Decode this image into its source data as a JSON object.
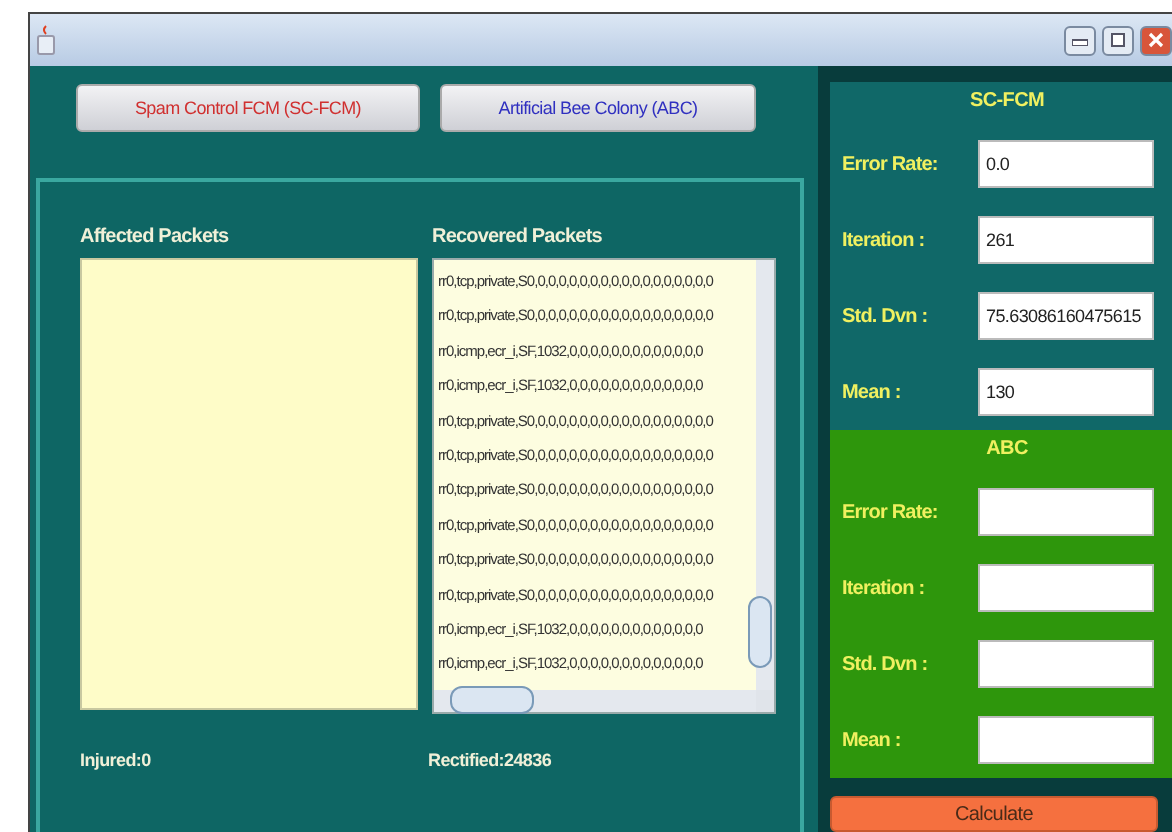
{
  "buttons": [
    {
      "label": "Spam Control FCM (SC-FCM)",
      "color": "#d03030"
    },
    {
      "label": "Artificial Bee Colony (ABC)",
      "color": "#3030c0"
    }
  ],
  "affected": {
    "label": "Affected Packets"
  },
  "recovered": {
    "label": "Recovered Packets",
    "rows": [
      "rr0,tcp,private,S0,0,0,0,0,0,0,0,0,0,0,0,0,0,0,0,0,0",
      "rr0,tcp,private,S0,0,0,0,0,0,0,0,0,0,0,0,0,0,0,0,0,0",
      "rr0,icmp,ecr_i,SF,1032,0,0,0,0,0,0,0,0,0,0,0,0,0",
      "rr0,icmp,ecr_i,SF,1032,0,0,0,0,0,0,0,0,0,0,0,0,0",
      "rr0,tcp,private,S0,0,0,0,0,0,0,0,0,0,0,0,0,0,0,0,0,0",
      "rr0,tcp,private,S0,0,0,0,0,0,0,0,0,0,0,0,0,0,0,0,0,0",
      "rr0,tcp,private,S0,0,0,0,0,0,0,0,0,0,0,0,0,0,0,0,0,0",
      "rr0,tcp,private,S0,0,0,0,0,0,0,0,0,0,0,0,0,0,0,0,0,0",
      "rr0,tcp,private,S0,0,0,0,0,0,0,0,0,0,0,0,0,0,0,0,0,0",
      "rr0,tcp,private,S0,0,0,0,0,0,0,0,0,0,0,0,0,0,0,0,0,0",
      "rr0,icmp,ecr_i,SF,1032,0,0,0,0,0,0,0,0,0,0,0,0,0",
      "rr0,icmp,ecr_i,SF,1032,0,0,0,0,0,0,0,0,0,0,0,0,0"
    ]
  },
  "footer": [
    "Injured:0",
    "Rectified:24836"
  ],
  "sections": [
    {
      "title": "SC-FCM",
      "color": "#106868",
      "fields": [
        {
          "label": "Error Rate:",
          "value": "0.0"
        },
        {
          "label": "Iteration  :",
          "value": "261"
        },
        {
          "label": "Std. Dvn :",
          "value": "75.63086160475615"
        },
        {
          "label": "Mean :",
          "value": "130"
        }
      ]
    },
    {
      "title": "ABC",
      "color": "#2e960c",
      "fields": [
        {
          "label": "Error Rate:"
        },
        {
          "label": "Iteration  :"
        },
        {
          "label": "Std. Dvn :"
        },
        {
          "label": "Mean :"
        }
      ]
    }
  ],
  "calculate": {
    "label": "Calculate"
  }
}
